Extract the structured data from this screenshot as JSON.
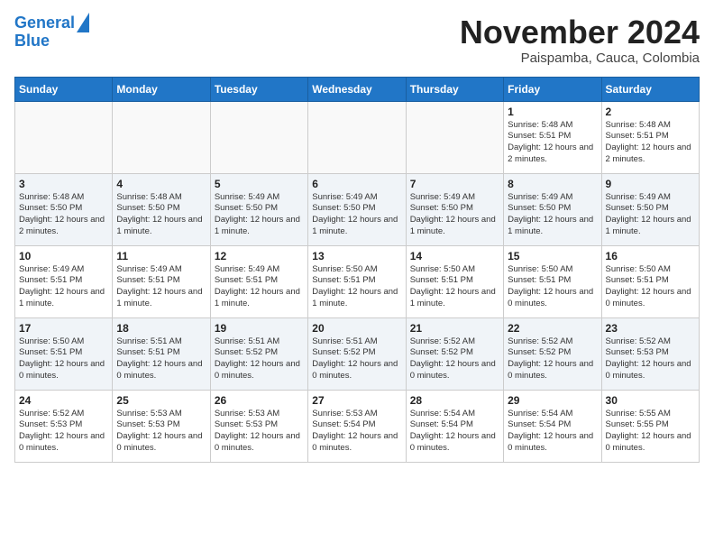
{
  "header": {
    "logo_line1": "General",
    "logo_line2": "Blue",
    "title": "November 2024",
    "subtitle": "Paispamba, Cauca, Colombia"
  },
  "days_of_week": [
    "Sunday",
    "Monday",
    "Tuesday",
    "Wednesday",
    "Thursday",
    "Friday",
    "Saturday"
  ],
  "weeks": [
    [
      {
        "day": "",
        "info": ""
      },
      {
        "day": "",
        "info": ""
      },
      {
        "day": "",
        "info": ""
      },
      {
        "day": "",
        "info": ""
      },
      {
        "day": "",
        "info": ""
      },
      {
        "day": "1",
        "info": "Sunrise: 5:48 AM\nSunset: 5:51 PM\nDaylight: 12 hours and 2 minutes."
      },
      {
        "day": "2",
        "info": "Sunrise: 5:48 AM\nSunset: 5:51 PM\nDaylight: 12 hours and 2 minutes."
      }
    ],
    [
      {
        "day": "3",
        "info": "Sunrise: 5:48 AM\nSunset: 5:50 PM\nDaylight: 12 hours and 2 minutes."
      },
      {
        "day": "4",
        "info": "Sunrise: 5:48 AM\nSunset: 5:50 PM\nDaylight: 12 hours and 1 minute."
      },
      {
        "day": "5",
        "info": "Sunrise: 5:49 AM\nSunset: 5:50 PM\nDaylight: 12 hours and 1 minute."
      },
      {
        "day": "6",
        "info": "Sunrise: 5:49 AM\nSunset: 5:50 PM\nDaylight: 12 hours and 1 minute."
      },
      {
        "day": "7",
        "info": "Sunrise: 5:49 AM\nSunset: 5:50 PM\nDaylight: 12 hours and 1 minute."
      },
      {
        "day": "8",
        "info": "Sunrise: 5:49 AM\nSunset: 5:50 PM\nDaylight: 12 hours and 1 minute."
      },
      {
        "day": "9",
        "info": "Sunrise: 5:49 AM\nSunset: 5:50 PM\nDaylight: 12 hours and 1 minute."
      }
    ],
    [
      {
        "day": "10",
        "info": "Sunrise: 5:49 AM\nSunset: 5:51 PM\nDaylight: 12 hours and 1 minute."
      },
      {
        "day": "11",
        "info": "Sunrise: 5:49 AM\nSunset: 5:51 PM\nDaylight: 12 hours and 1 minute."
      },
      {
        "day": "12",
        "info": "Sunrise: 5:49 AM\nSunset: 5:51 PM\nDaylight: 12 hours and 1 minute."
      },
      {
        "day": "13",
        "info": "Sunrise: 5:50 AM\nSunset: 5:51 PM\nDaylight: 12 hours and 1 minute."
      },
      {
        "day": "14",
        "info": "Sunrise: 5:50 AM\nSunset: 5:51 PM\nDaylight: 12 hours and 1 minute."
      },
      {
        "day": "15",
        "info": "Sunrise: 5:50 AM\nSunset: 5:51 PM\nDaylight: 12 hours and 0 minutes."
      },
      {
        "day": "16",
        "info": "Sunrise: 5:50 AM\nSunset: 5:51 PM\nDaylight: 12 hours and 0 minutes."
      }
    ],
    [
      {
        "day": "17",
        "info": "Sunrise: 5:50 AM\nSunset: 5:51 PM\nDaylight: 12 hours and 0 minutes."
      },
      {
        "day": "18",
        "info": "Sunrise: 5:51 AM\nSunset: 5:51 PM\nDaylight: 12 hours and 0 minutes."
      },
      {
        "day": "19",
        "info": "Sunrise: 5:51 AM\nSunset: 5:52 PM\nDaylight: 12 hours and 0 minutes."
      },
      {
        "day": "20",
        "info": "Sunrise: 5:51 AM\nSunset: 5:52 PM\nDaylight: 12 hours and 0 minutes."
      },
      {
        "day": "21",
        "info": "Sunrise: 5:52 AM\nSunset: 5:52 PM\nDaylight: 12 hours and 0 minutes."
      },
      {
        "day": "22",
        "info": "Sunrise: 5:52 AM\nSunset: 5:52 PM\nDaylight: 12 hours and 0 minutes."
      },
      {
        "day": "23",
        "info": "Sunrise: 5:52 AM\nSunset: 5:53 PM\nDaylight: 12 hours and 0 minutes."
      }
    ],
    [
      {
        "day": "24",
        "info": "Sunrise: 5:52 AM\nSunset: 5:53 PM\nDaylight: 12 hours and 0 minutes."
      },
      {
        "day": "25",
        "info": "Sunrise: 5:53 AM\nSunset: 5:53 PM\nDaylight: 12 hours and 0 minutes."
      },
      {
        "day": "26",
        "info": "Sunrise: 5:53 AM\nSunset: 5:53 PM\nDaylight: 12 hours and 0 minutes."
      },
      {
        "day": "27",
        "info": "Sunrise: 5:53 AM\nSunset: 5:54 PM\nDaylight: 12 hours and 0 minutes."
      },
      {
        "day": "28",
        "info": "Sunrise: 5:54 AM\nSunset: 5:54 PM\nDaylight: 12 hours and 0 minutes."
      },
      {
        "day": "29",
        "info": "Sunrise: 5:54 AM\nSunset: 5:54 PM\nDaylight: 12 hours and 0 minutes."
      },
      {
        "day": "30",
        "info": "Sunrise: 5:55 AM\nSunset: 5:55 PM\nDaylight: 12 hours and 0 minutes."
      }
    ]
  ]
}
